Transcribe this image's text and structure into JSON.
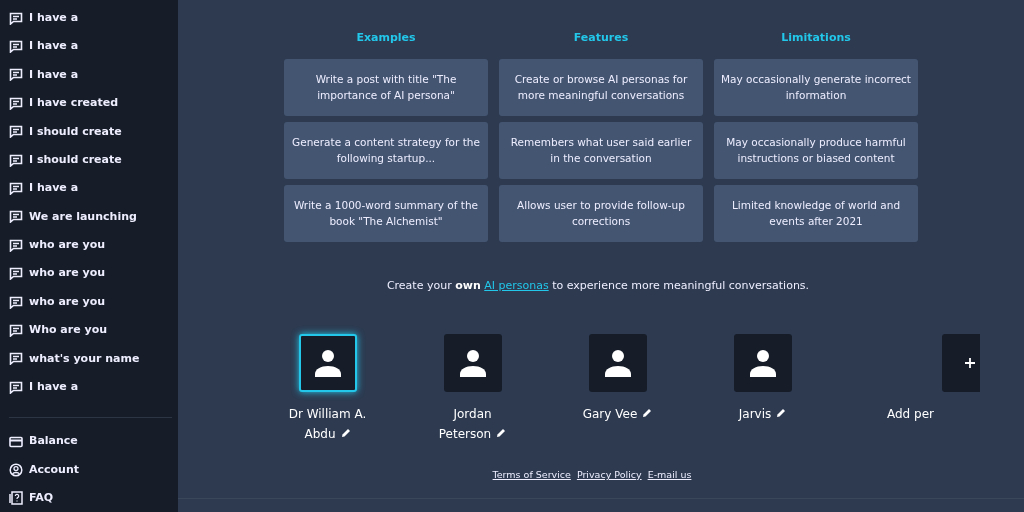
{
  "sidebar": {
    "history": [
      {
        "label": "I have a"
      },
      {
        "label": "I have a"
      },
      {
        "label": "I have a"
      },
      {
        "label": "I have created"
      },
      {
        "label": "I should create"
      },
      {
        "label": "I should create"
      },
      {
        "label": "I have a"
      },
      {
        "label": "We are launching"
      },
      {
        "label": "who are you"
      },
      {
        "label": "who are you"
      },
      {
        "label": "who are you"
      },
      {
        "label": "Who are you"
      },
      {
        "label": "what's your name"
      },
      {
        "label": "I have a"
      }
    ],
    "menu": [
      {
        "kind": "card",
        "label": "Balance"
      },
      {
        "kind": "account",
        "label": "Account"
      },
      {
        "kind": "faq",
        "label": "FAQ"
      }
    ]
  },
  "columns": [
    {
      "title": "Examples",
      "items": [
        "Write a post with title \"The importance of AI persona\"",
        "Generate a content strategy for the following startup...",
        "Write a 1000-word summary of the book \"The Alchemist\""
      ]
    },
    {
      "title": "Features",
      "items": [
        "Create or browse AI personas for more meaningful conversations",
        "Remembers what user said earlier in the conversation",
        "Allows user to provide follow-up corrections"
      ]
    },
    {
      "title": "Limitations",
      "items": [
        "May occasionally generate incorrect information",
        "May occasionally produce harmful instructions or biased content",
        "Limited knowledge of world and events after 2021"
      ]
    }
  ],
  "intro": {
    "before": "Create your **own**",
    "link": "AI personas",
    "after": "to experience more meaningful conversations."
  },
  "personas": [
    {
      "kind": "persona",
      "name": "Dr William A. Abdu",
      "selected": true
    },
    {
      "kind": "persona",
      "name": "Jordan Peterson",
      "selected": false
    },
    {
      "kind": "persona",
      "name": "Gary Vee",
      "selected": false
    },
    {
      "kind": "persona",
      "name": "Jarvis",
      "selected": false
    },
    {
      "kind": "add",
      "name": "Add per",
      "selected": false
    }
  ],
  "footer_links": [
    "Terms of Service",
    "Privacy Policy",
    "E-mail us"
  ]
}
